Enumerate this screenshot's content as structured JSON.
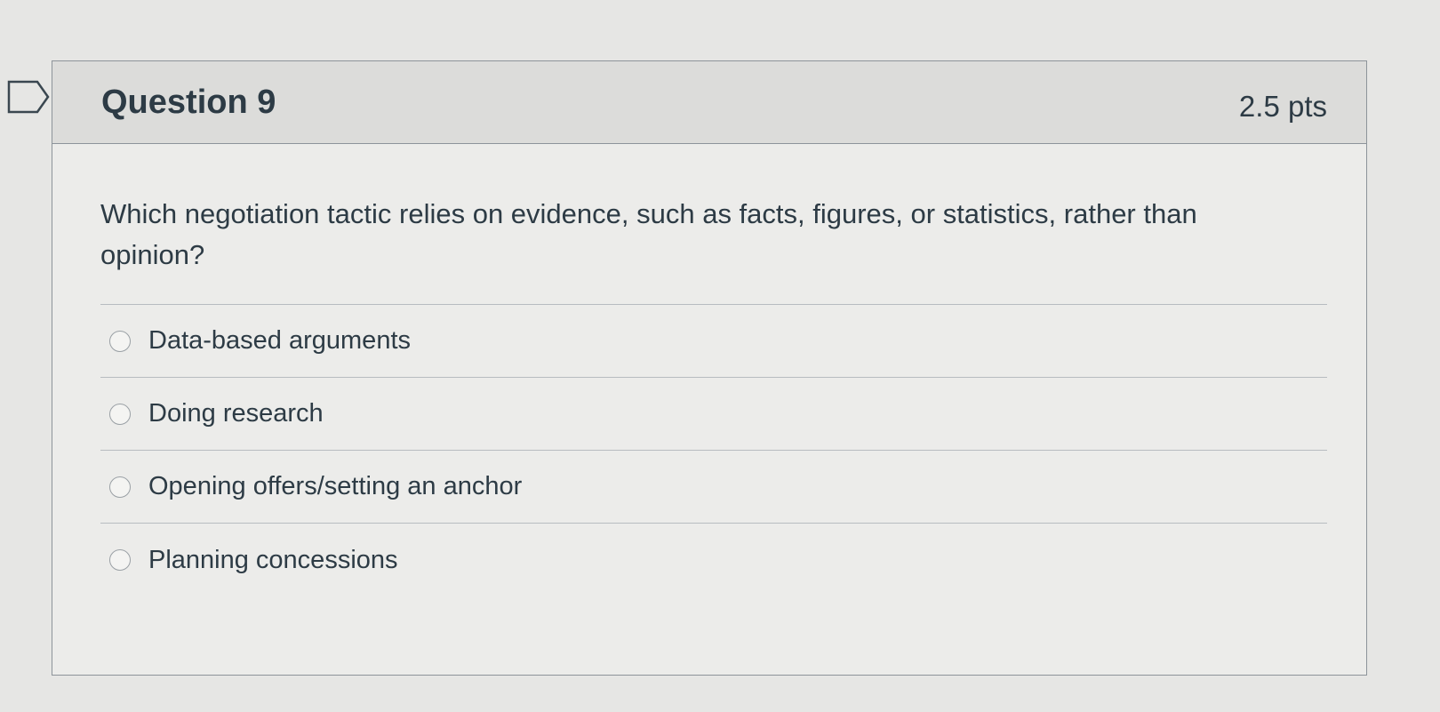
{
  "question": {
    "title": "Question 9",
    "points": "2.5 pts",
    "text": "Which negotiation tactic relies on evidence, such as facts, figures, or statistics, rather than opinion?",
    "flag_icon": "flag-outline-icon",
    "answers": [
      {
        "label": "Data-based arguments"
      },
      {
        "label": "Doing research"
      },
      {
        "label": "Opening offers/setting an anchor"
      },
      {
        "label": "Planning concessions"
      }
    ]
  }
}
